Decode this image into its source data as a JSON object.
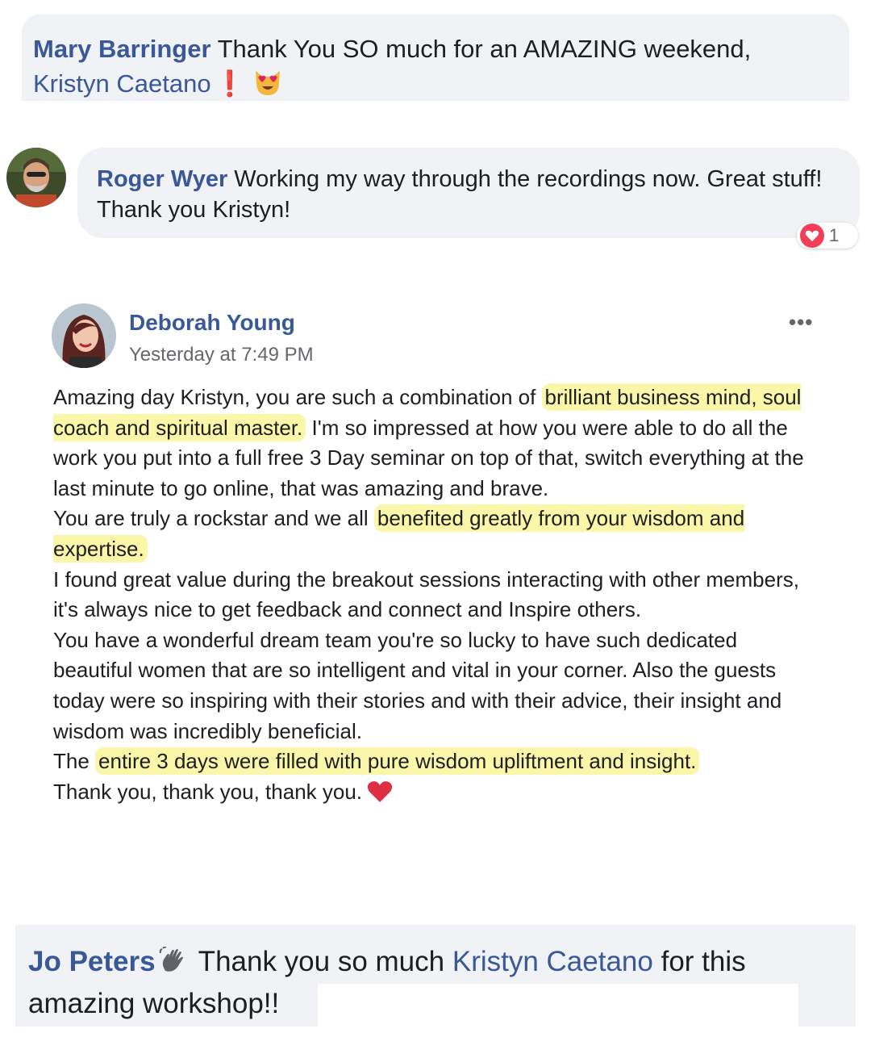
{
  "comment1": {
    "author": "Mary Barringer",
    "text": "Thank You SO much for an AMAZING weekend,",
    "mention": "Kristyn Caetano",
    "emoji_exclamation": "❗",
    "emoji_icon": "heart-eyes-cat-emoji"
  },
  "comment2": {
    "author": "Roger Wyer",
    "text": "Working my way through the recordings now. Great stuff! Thank you Kristyn!",
    "reaction_count": "1",
    "reaction_icon": "heart-reaction-icon"
  },
  "post": {
    "author": "Deborah Young",
    "timestamp": "Yesterday at 7:49 PM",
    "more_label": "•••",
    "p1_a": "Amazing day Kristyn, you are such a combination of ",
    "p1_hl": "brilliant business mind, soul coach and spiritual master.",
    "p1_b": " I'm so impressed at how you were able to do all the work you put into a full free 3 Day seminar on top of that, switch everything at the last minute to go online, that was amazing and brave.",
    "p2_a": "You are truly a rockstar and we all ",
    "p2_hl": "benefited greatly from your wisdom and expertise.",
    "p3": "I found great value during the breakout sessions interacting with other members, it's always nice to get feedback and connect and Inspire others.",
    "p4": "You have a wonderful dream team you're so lucky to have such dedicated beautiful women that are so intelligent and vital in your corner. Also the guests today were so inspiring with their stories and with their advice, their insight and wisdom was incredibly beneficial.",
    "p5_a": "The ",
    "p5_hl": "entire 3 days were filled with pure wisdom upliftment and insight.",
    "p6": "Thank you, thank you, thank you.",
    "highlight_color": "#fbf7a8"
  },
  "comment3": {
    "author": "Jo Peters",
    "text_a": " Thank you so much ",
    "mention": "Kristyn Caetano",
    "text_b": " for this amazing workshop!!",
    "author_icon": "waving-hand-icon"
  },
  "colors": {
    "name_blue": "#385898",
    "bubble_bg": "#f0f2f5",
    "text": "#1c1e21",
    "meta_gray": "#65676b"
  }
}
